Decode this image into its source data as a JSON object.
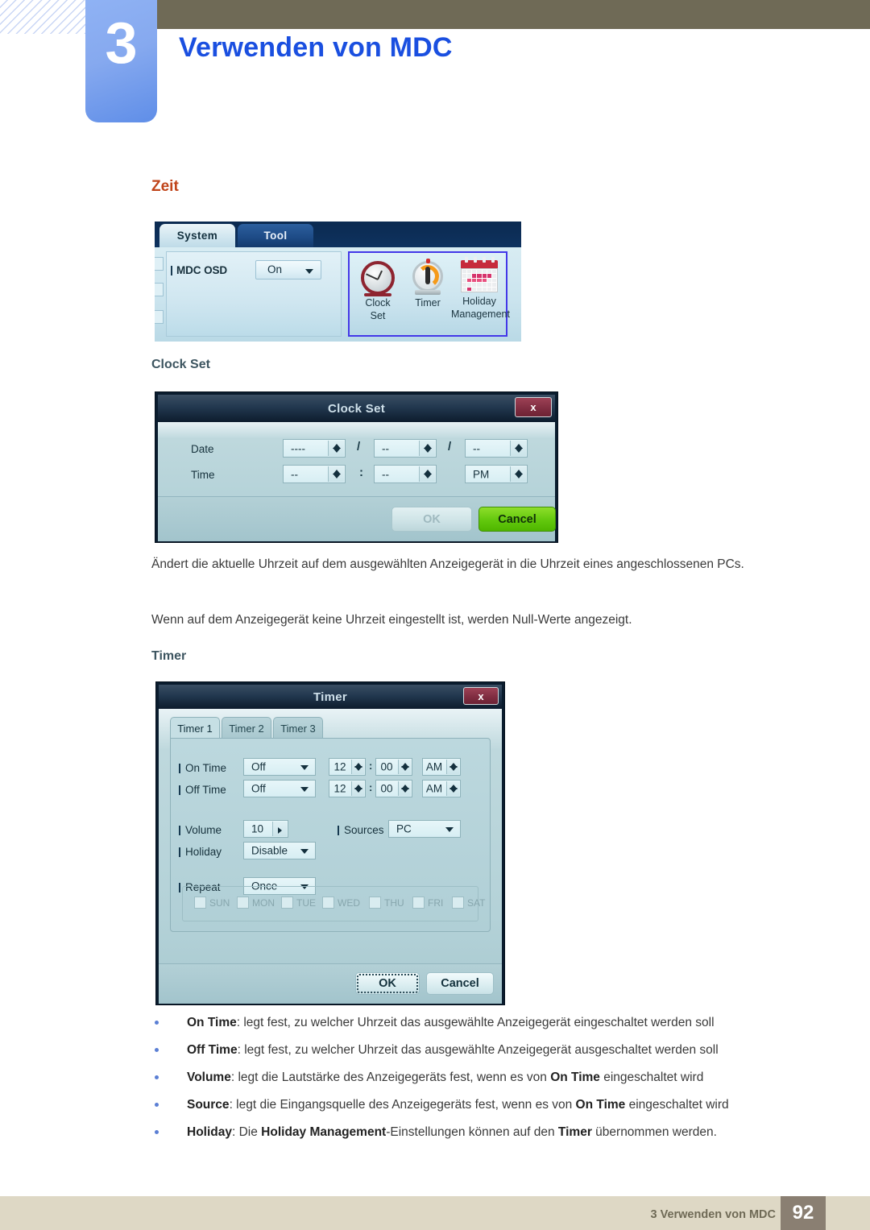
{
  "header": {
    "chapter_number": "3",
    "title": "Verwenden von MDC"
  },
  "sections": {
    "zeit_heading": "Zeit",
    "clock_set_heading": "Clock Set",
    "timer_heading": "Timer"
  },
  "system_panel": {
    "tabs": [
      {
        "label": "System",
        "active": true
      },
      {
        "label": "Tool",
        "active": false
      }
    ],
    "mdc_osd_label": "MDC OSD",
    "mdc_osd_value": "On",
    "icons": [
      {
        "name": "clock-set-icon",
        "caption_line1": "Clock",
        "caption_line2": "Set"
      },
      {
        "name": "timer-icon",
        "caption_line1": "Timer",
        "caption_line2": ""
      },
      {
        "name": "holiday-management-icon",
        "caption_line1": "Holiday",
        "caption_line2": "Management"
      }
    ]
  },
  "clock_set_dialog": {
    "title": "Clock Set",
    "close_label": "x",
    "date_label": "Date",
    "time_label": "Time",
    "date_year": "----",
    "date_month": "--",
    "date_day": "--",
    "date_sep1": "/",
    "date_sep2": "/",
    "time_hour": "--",
    "time_minute": "--",
    "time_meridiem": "PM",
    "time_sep": ":",
    "ok_label": "OK",
    "cancel_label": "Cancel"
  },
  "paragraphs": {
    "p1": "Ändert die aktuelle Uhrzeit auf dem ausgewählten Anzeigegerät in die Uhrzeit eines angeschlossenen PCs.",
    "p2": "Wenn auf dem Anzeigegerät keine Uhrzeit eingestellt ist, werden Null-Werte angezeigt."
  },
  "timer_dialog": {
    "title": "Timer",
    "close_label": "x",
    "tabs": [
      {
        "label": "Timer 1",
        "active": true
      },
      {
        "label": "Timer 2",
        "active": false
      },
      {
        "label": "Timer 3",
        "active": false
      }
    ],
    "on_time_label": "On Time",
    "on_time_mode": "Off",
    "on_time_hour": "12",
    "on_time_minute": "00",
    "on_time_meridiem": "AM",
    "off_time_label": "Off Time",
    "off_time_mode": "Off",
    "off_time_hour": "12",
    "off_time_minute": "00",
    "off_time_meridiem": "AM",
    "time_sep": ":",
    "volume_label": "Volume",
    "volume_value": "10",
    "sources_label": "Sources",
    "sources_value": "PC",
    "holiday_label": "Holiday",
    "holiday_value": "Disable",
    "repeat_label": "Repeat",
    "repeat_value": "Once",
    "days": [
      "SUN",
      "MON",
      "TUE",
      "WED",
      "THU",
      "FRI",
      "SAT"
    ],
    "ok_label": "OK",
    "cancel_label": "Cancel"
  },
  "bullets": [
    {
      "term": "On Time",
      "rest": ": legt fest, zu welcher Uhrzeit das ausgewählte Anzeigegerät eingeschaltet werden soll"
    },
    {
      "term": "Off Time",
      "rest": ": legt fest, zu welcher Uhrzeit das ausgewählte Anzeigegerät ausgeschaltet werden soll"
    },
    {
      "term": "Volume",
      "rest": ": legt die Lautstärke des Anzeigegeräts fest, wenn es von ",
      "term2": "On Time",
      "rest2": " eingeschaltet wird"
    },
    {
      "term": "Source",
      "rest": ": legt die Eingangsquelle des Anzeigegeräts fest, wenn es von ",
      "term2": "On Time",
      "rest2": " eingeschaltet wird"
    },
    {
      "term": "Holiday",
      "rest": ": Die ",
      "term2": "Holiday Management",
      "rest2": "-Einstellungen können auf den ",
      "term3": "Timer",
      "rest3": " übernommen werden."
    }
  ],
  "footer": {
    "text": "3 Verwenden von MDC",
    "page_number": "92"
  },
  "colors": {
    "title_blue": "#1a4fe0",
    "heading_orange": "#c0441a",
    "subheading": "#3d5560",
    "header_band": "#6f6a56",
    "footer_band": "#ded8c5",
    "page_badge": "#8a7f72",
    "selection_border": "#4338e8",
    "cancel_green": "#62c80d",
    "close_red": "#7e2c40"
  }
}
